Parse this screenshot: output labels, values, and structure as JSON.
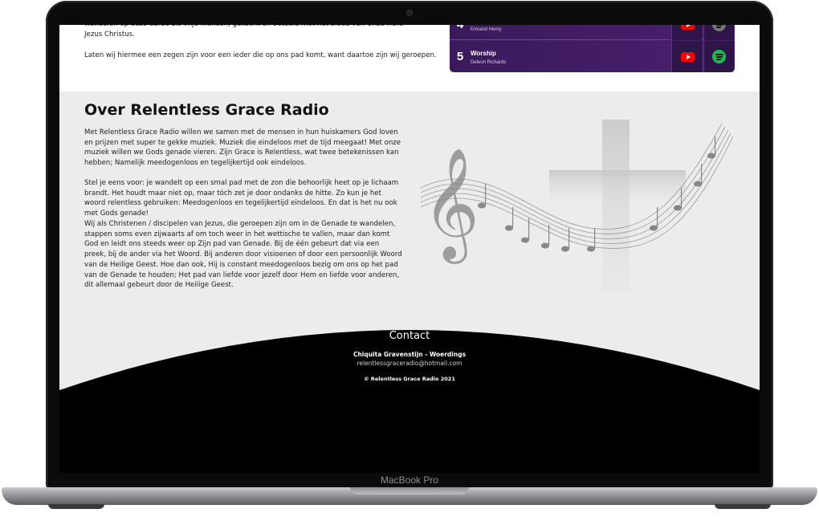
{
  "device": {
    "brand_label": "MacBook Pro"
  },
  "intro": {
    "continued_text": "wandelen op deze aarde als vrije mensen, gekocht en betaald met het bloed van Onze Here Jezus Christus.",
    "blessing_text": "Laten wij hiermee een zegen zijn voor een ieder die op ons pad komt, want daartoe zijn wij geroepen."
  },
  "playlist": {
    "items": [
      {
        "rank": "4",
        "title": "",
        "artist": "Emrand Henry"
      },
      {
        "rank": "5",
        "title": "Worship",
        "artist": "Deleon Richards"
      }
    ],
    "colors": {
      "background": "#4a1f6e",
      "youtube": "#ff0000",
      "spotify": "#1db954"
    }
  },
  "about": {
    "title": "Over Relentless Grace Radio",
    "paragraphs": [
      "Met Relentless Grace Radio willen we samen met de mensen in hun huiskamers God loven en prijzen met super te gekke muziek. Muziek die eindeloos met de tijd meegaat! Met onze muziek willen we Gods genade vieren. Zijn Grace is Relentless, wat twee betekenissen kan hebben; Namelijk meedogenloos en tegelijkertijd ook eindeloos.",
      "Stel je eens voor: je wandelt op een smal pad met de zon die behoorlijk heet op je lichaam brandt. Het houdt maar niet op, maar tóch zet je door ondanks de hitte. Zo kun je het woord relentless gebruiken: Meedogenloos en tegelijkertijd eindeloos. En dat is het nu ook met Gods genade!",
      "Wij als Christenen / discipelen van Jezus, die geroepen zijn om in de Genade te wandelen, stappen soms even zijwaarts af om toch weer in het wettische te vallen, maar dan komt God en leidt ons steeds weer op Zijn pad van Genade. Bij de één gebeurt dat via een preek, bij de ander via het Woord. Bij anderen door visioenen of door een persoonlijk Woord van de Heilige Geest. Hoe dan ook, Hij is constant meedogenloos bezig om ons op het pad van de Genade te houden; Het pad van liefde voor jezelf door Hem en liefde voor anderen, dit allemaal gebeurt door de Heilige Geest."
    ]
  },
  "contact": {
    "title": "Contact",
    "name": "Chiquita Gravenstijn - Woerdings",
    "email": "relentlessgraceradio@hotmail.com",
    "copyright": "© Relentless Grace Radio 2021"
  }
}
